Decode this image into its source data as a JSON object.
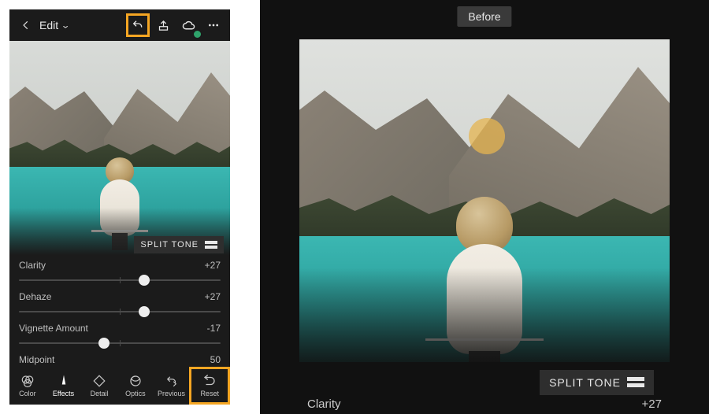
{
  "header": {
    "edit_label": "Edit"
  },
  "panel": {
    "split_tone": "SPLIT TONE"
  },
  "sliders": [
    {
      "label": "Clarity",
      "value": "+27",
      "pos": 62
    },
    {
      "label": "Dehaze",
      "value": "+27",
      "pos": 62
    },
    {
      "label": "Vignette Amount",
      "value": "-17",
      "pos": 42
    },
    {
      "label": "Midpoint",
      "value": "50",
      "pos": 50
    }
  ],
  "tools": {
    "color": "Color",
    "effects": "Effects",
    "detail": "Detail",
    "optics": "Optics",
    "previous": "Previous",
    "reset": "Reset"
  },
  "preview": {
    "before_label": "Before",
    "split_tone": "SPLIT TONE",
    "clarity_label": "Clarity",
    "clarity_value": "+27"
  }
}
